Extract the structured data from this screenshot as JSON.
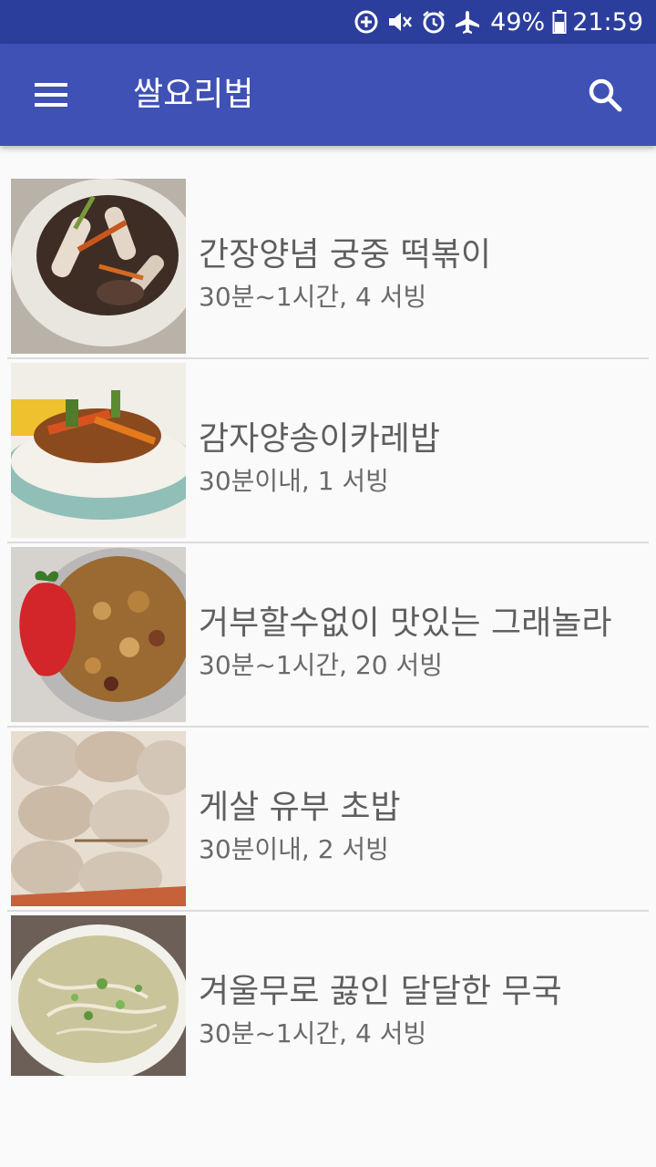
{
  "status_bar": {
    "battery": "49%",
    "time": "21:59",
    "icons": [
      "data-saver-icon",
      "mute-icon",
      "alarm-icon",
      "airplane-icon",
      "battery-icon"
    ]
  },
  "app_bar": {
    "title": "쌀요리법",
    "menu_icon": "menu-icon",
    "search_icon": "search-icon",
    "color": "#3f51b5",
    "status_color": "#2c3e9c"
  },
  "recipes": [
    {
      "title": "간장양념 궁중 떡볶이",
      "meta": "30분~1시간, 4 서빙"
    },
    {
      "title": "감자양송이카레밥",
      "meta": "30분이내, 1 서빙"
    },
    {
      "title": "거부할수없이 맛있는 그래놀라",
      "meta": "30분~1시간, 20 서빙"
    },
    {
      "title": "게살 유부 초밥",
      "meta": "30분이내, 2 서빙"
    },
    {
      "title": "겨울무로 끓인 달달한 무국",
      "meta": "30분~1시간, 4 서빙"
    }
  ]
}
